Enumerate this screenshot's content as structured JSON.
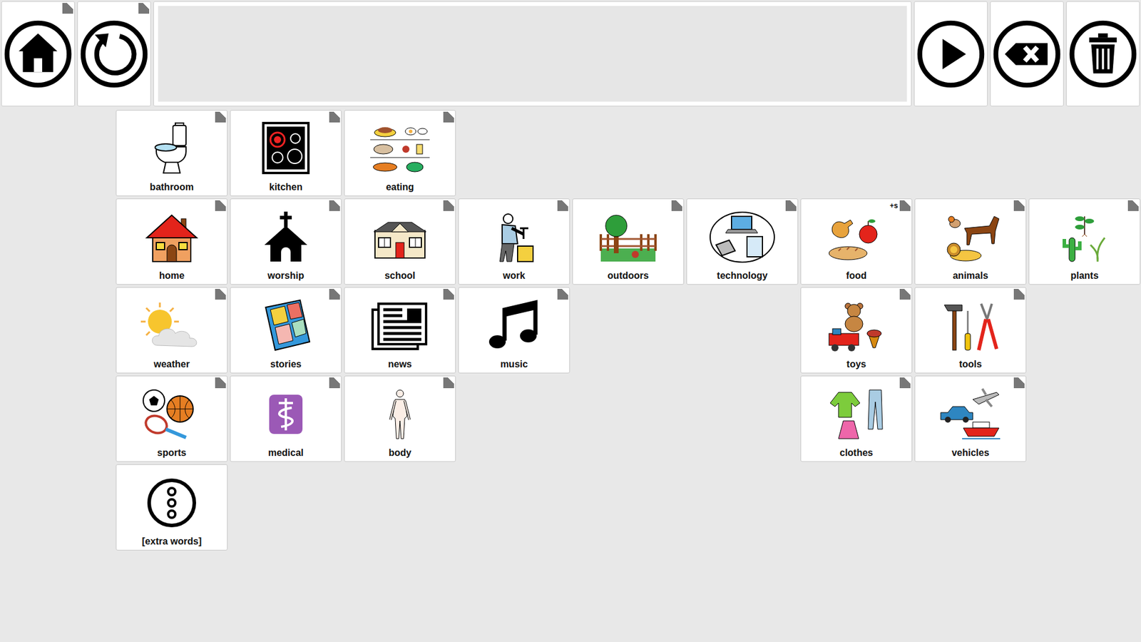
{
  "toolbar": {
    "left_buttons": [
      {
        "kind": "home",
        "folder": true
      },
      {
        "kind": "back",
        "folder": true
      }
    ],
    "message": "",
    "right_buttons": [
      {
        "kind": "play",
        "folder": false
      },
      {
        "kind": "backspace",
        "folder": false
      },
      {
        "kind": "clear",
        "folder": false
      }
    ]
  },
  "grid": {
    "rows": [
      [
        {
          "label": "bathroom",
          "kind": "toilet",
          "folder": true,
          "badge": ""
        },
        {
          "label": "kitchen",
          "kind": "stove",
          "folder": true,
          "badge": ""
        },
        {
          "label": "eating",
          "kind": "meal",
          "folder": true,
          "badge": ""
        },
        null,
        null,
        null,
        null,
        null,
        null
      ],
      [
        {
          "label": "home",
          "kind": "house",
          "folder": true,
          "badge": ""
        },
        {
          "label": "worship",
          "kind": "church",
          "folder": true,
          "badge": ""
        },
        {
          "label": "school",
          "kind": "schoolhouse",
          "folder": true,
          "badge": ""
        },
        {
          "label": "work",
          "kind": "worker",
          "folder": true,
          "badge": ""
        },
        {
          "label": "outdoors",
          "kind": "park",
          "folder": true,
          "badge": ""
        },
        {
          "label": "technology",
          "kind": "devices",
          "folder": true,
          "badge": ""
        },
        {
          "label": "food",
          "kind": "groceries",
          "folder": true,
          "badge": "+s"
        },
        {
          "label": "animals",
          "kind": "creatures",
          "folder": true,
          "badge": ""
        },
        {
          "label": "plants",
          "kind": "greenery",
          "folder": true,
          "badge": ""
        }
      ],
      [
        {
          "label": "weather",
          "kind": "sun",
          "folder": true,
          "badge": ""
        },
        {
          "label": "stories",
          "kind": "book",
          "folder": true,
          "badge": ""
        },
        {
          "label": "news",
          "kind": "paper",
          "folder": true,
          "badge": ""
        },
        {
          "label": "music",
          "kind": "note",
          "folder": true,
          "badge": ""
        },
        null,
        null,
        {
          "label": "toys",
          "kind": "teddy",
          "folder": true,
          "badge": ""
        },
        {
          "label": "tools",
          "kind": "toolset",
          "folder": true,
          "badge": ""
        },
        null
      ],
      [
        {
          "label": "sports",
          "kind": "balls",
          "folder": true,
          "badge": ""
        },
        {
          "label": "medical",
          "kind": "caduceus",
          "folder": true,
          "badge": ""
        },
        {
          "label": "body",
          "kind": "figure",
          "folder": true,
          "badge": ""
        },
        null,
        null,
        null,
        {
          "label": "clothes",
          "kind": "garments",
          "folder": true,
          "badge": ""
        },
        {
          "label": "vehicles",
          "kind": "transport",
          "folder": true,
          "badge": ""
        },
        null
      ],
      [
        {
          "label": "[extra words]",
          "kind": "ellipsis",
          "folder": false,
          "badge": ""
        },
        null,
        null,
        null,
        null,
        null,
        null,
        null,
        null
      ]
    ]
  }
}
